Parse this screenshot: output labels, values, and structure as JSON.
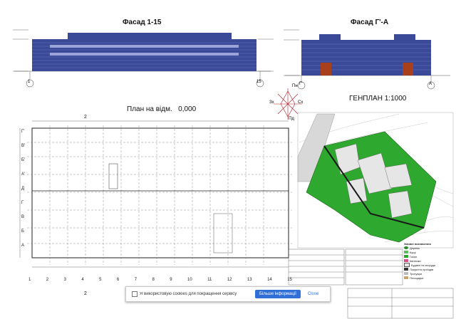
{
  "facades": {
    "left_title": "Фасад 1-15",
    "right_title": "Фасад Г'-А",
    "left_axis_a": "1",
    "left_axis_b": "15",
    "right_axis_a": "Г'",
    "right_axis_b": "А"
  },
  "plan": {
    "title": "План на відм.   0,000",
    "section_mark": "2",
    "row_axes": [
      "Г'",
      "В'",
      "Б'",
      "А'",
      "Д",
      "Г",
      "В",
      "Б",
      "А"
    ],
    "col_axes": [
      "1",
      "2",
      "3",
      "4",
      "5",
      "6",
      "7",
      "8",
      "9",
      "10",
      "11",
      "12",
      "13",
      "14",
      "15"
    ]
  },
  "genplan": {
    "title": "ГЕНПЛАН 1:1000",
    "legend_title": "Умовні позначення",
    "legend": [
      "Дерева",
      "Кущі",
      "Газон",
      "Квітники",
      "Будівлі та споруди",
      "Покриття проїздів",
      "Тротуари",
      "Площадки"
    ]
  },
  "compass": {
    "north": "Пн",
    "west": "Зх",
    "east": "Сх",
    "south": "Пд"
  },
  "cookie_banner": {
    "text": "Я використовую cookies для покращення сервісу",
    "more_button": "Більше інформації",
    "close_button": "Close"
  },
  "colors": {
    "facade_blue": "#3a4a98",
    "grass": "#2fa82f",
    "door": "#a8401c",
    "button": "#2f6fd6"
  }
}
